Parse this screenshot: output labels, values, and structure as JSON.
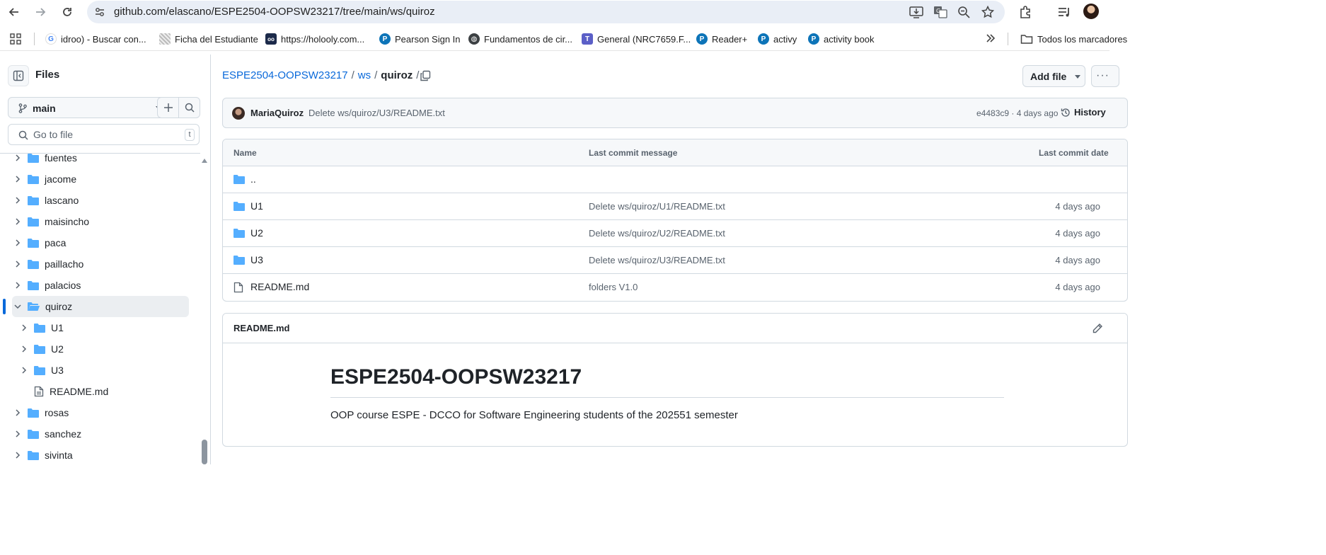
{
  "browser": {
    "url": "github.com/elascano/ESPE2504-OOPSW23217/tree/main/ws/quiroz",
    "bookmarks": [
      {
        "label": "idroo) - Buscar con...",
        "icon": "google-icon",
        "color": "#4285f4"
      },
      {
        "label": "Ficha del Estudiante",
        "icon": "image-icon",
        "color": "#9aa0a6"
      },
      {
        "label": "https://holooly.com...",
        "icon": "holooly-icon",
        "color": "#1c2a4a"
      },
      {
        "label": "Pearson Sign In",
        "icon": "pearson-icon",
        "color": "#0d74b8"
      },
      {
        "label": "Fundamentos de cir...",
        "icon": "globe-icon",
        "color": "#3c4043"
      },
      {
        "label": "General (NRC7659.F...",
        "icon": "teams-icon",
        "color": "#5b5fc7"
      },
      {
        "label": "Reader+",
        "icon": "pearson-icon",
        "color": "#0d74b8"
      },
      {
        "label": "activy",
        "icon": "pearson-icon",
        "color": "#0d74b8"
      },
      {
        "label": "activity book",
        "icon": "pearson-icon",
        "color": "#0d74b8"
      }
    ],
    "all_bookmarks": "Todos los marcadores"
  },
  "sidebar": {
    "title": "Files",
    "branch": "main",
    "goto_placeholder": "Go to file",
    "goto_shortcut": "t",
    "tree": [
      {
        "label": "fuentes",
        "level": 0,
        "type": "folder",
        "expanded": false
      },
      {
        "label": "jacome",
        "level": 0,
        "type": "folder",
        "expanded": false
      },
      {
        "label": "lascano",
        "level": 0,
        "type": "folder",
        "expanded": false
      },
      {
        "label": "maisincho",
        "level": 0,
        "type": "folder",
        "expanded": false
      },
      {
        "label": "paca",
        "level": 0,
        "type": "folder",
        "expanded": false
      },
      {
        "label": "paillacho",
        "level": 0,
        "type": "folder",
        "expanded": false
      },
      {
        "label": "palacios",
        "level": 0,
        "type": "folder",
        "expanded": false
      },
      {
        "label": "quiroz",
        "level": 0,
        "type": "folder",
        "expanded": true,
        "selected": true
      },
      {
        "label": "U1",
        "level": 1,
        "type": "folder",
        "expanded": false
      },
      {
        "label": "U2",
        "level": 1,
        "type": "folder",
        "expanded": false
      },
      {
        "label": "U3",
        "level": 1,
        "type": "folder",
        "expanded": false
      },
      {
        "label": "README.md",
        "level": 1,
        "type": "file"
      },
      {
        "label": "rosas",
        "level": 0,
        "type": "folder",
        "expanded": false
      },
      {
        "label": "sanchez",
        "level": 0,
        "type": "folder",
        "expanded": false
      },
      {
        "label": "sivinta",
        "level": 0,
        "type": "folder",
        "expanded": false
      }
    ]
  },
  "breadcrumb": {
    "repo": "ESPE2504-OOPSW23217",
    "folder": "ws",
    "current": "quiroz",
    "trailing": "/"
  },
  "actions": {
    "add_file": "Add file"
  },
  "latest_commit": {
    "author": "MariaQuiroz",
    "message": "Delete ws/quiroz/U3/README.txt",
    "sha_age": "e4483c9 · 4 days ago",
    "history": "History"
  },
  "file_table": {
    "headers": {
      "name": "Name",
      "message": "Last commit message",
      "date": "Last commit date"
    },
    "rows": [
      {
        "name": "..",
        "type": "folder",
        "message": "",
        "date": ""
      },
      {
        "name": "U1",
        "type": "folder",
        "message": "Delete ws/quiroz/U1/README.txt",
        "date": "4 days ago"
      },
      {
        "name": "U2",
        "type": "folder",
        "message": "Delete ws/quiroz/U2/README.txt",
        "date": "4 days ago"
      },
      {
        "name": "U3",
        "type": "folder",
        "message": "Delete ws/quiroz/U3/README.txt",
        "date": "4 days ago"
      },
      {
        "name": "README.md",
        "type": "file",
        "message": "folders V1.0",
        "date": "4 days ago"
      }
    ]
  },
  "readme": {
    "filename": "README.md",
    "heading": "ESPE2504-OOPSW23217",
    "paragraph": "OOP course ESPE - DCCO for Software Engineering students of the 202551 semester"
  },
  "colors": {
    "link": "#0969da",
    "folder": "#54aeff",
    "muted": "#59636e",
    "border": "#d1d9e0"
  }
}
